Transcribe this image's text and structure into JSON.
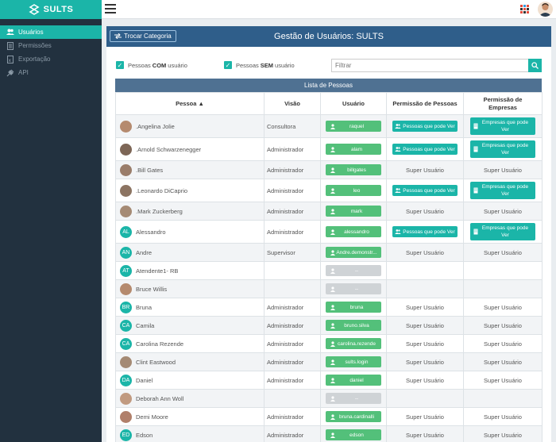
{
  "app": {
    "logo_text": "SULTS"
  },
  "sidebar": {
    "items": [
      {
        "label": "Usuários",
        "icon": "users-icon",
        "active": true
      },
      {
        "label": "Permissões",
        "icon": "document-icon",
        "active": false
      },
      {
        "label": "Exportação",
        "icon": "export-icon",
        "active": false
      },
      {
        "label": "API",
        "icon": "plug-icon",
        "active": false
      }
    ]
  },
  "panel": {
    "title": "Gestão de Usuários: SULTS",
    "category_button": "Trocar Categoria"
  },
  "filters": {
    "with_user_prefix": "Pessoas",
    "with_user_strong": "COM",
    "with_user_suffix": "usuário",
    "without_user_prefix": "Pessoas",
    "without_user_strong": "SEM",
    "without_user_suffix": "usuário",
    "filter_placeholder": "Filtrar"
  },
  "table": {
    "caption": "Lista de Pessoas",
    "headers": {
      "pessoa": "Pessoa",
      "visao": "Visão",
      "usuario": "Usuário",
      "perm_pessoas": "Permissão de Pessoas",
      "perm_empresas_1": "Permissão de",
      "perm_empresas_2": "Empresas"
    },
    "labels": {
      "pessoas_btn": "Pessoas que pode Ver",
      "empresas_btn_1": "Empresas que pode",
      "empresas_btn_2": "Ver",
      "super": "Super Usuário",
      "none": "--"
    },
    "rows": [
      {
        "name": ".Angelina Jolie",
        "initials": "",
        "visao": "Consultora",
        "user": "raquel",
        "pessoas": "btn",
        "empresas": "btn"
      },
      {
        "name": ".Arnold Schwarzenegger",
        "initials": "",
        "visao": "Administrador",
        "user": "alam",
        "pessoas": "btn",
        "empresas": "btn"
      },
      {
        "name": ".Bill Gates",
        "initials": "",
        "visao": "Administrador",
        "user": "billgates",
        "pessoas": "super",
        "empresas": "super"
      },
      {
        "name": ".Leonardo DiCaprio",
        "initials": "",
        "visao": "Administrador",
        "user": "leo",
        "pessoas": "btn",
        "empresas": "btn"
      },
      {
        "name": ".Mark Zuckerberg",
        "initials": "",
        "visao": "Administrador",
        "user": "mark",
        "pessoas": "super",
        "empresas": "super"
      },
      {
        "name": "Alessandro",
        "initials": "AL",
        "visao": "Administrador",
        "user": "alessandro",
        "pessoas": "btn",
        "empresas": "btn"
      },
      {
        "name": "Andre",
        "initials": "AN",
        "visao": "Supervisor",
        "user": "Andre.demonstr...",
        "pessoas": "super",
        "empresas": "super"
      },
      {
        "name": "Atendente1- RB",
        "initials": "AT",
        "visao": "",
        "user": "--",
        "pessoas": "",
        "empresas": ""
      },
      {
        "name": "Bruce Willis",
        "initials": "",
        "visao": "",
        "user": "--",
        "pessoas": "",
        "empresas": ""
      },
      {
        "name": "Bruna",
        "initials": "BR",
        "visao": "Administrador",
        "user": "bruna",
        "pessoas": "super",
        "empresas": "super"
      },
      {
        "name": "Camila",
        "initials": "CA",
        "visao": "Administrador",
        "user": "bruno.silva",
        "pessoas": "super",
        "empresas": "super"
      },
      {
        "name": "Carolina Rezende",
        "initials": "CA",
        "visao": "Administrador",
        "user": "carolina.rezende",
        "pessoas": "super",
        "empresas": "super"
      },
      {
        "name": "Clint Eastwood",
        "initials": "",
        "visao": "Administrador",
        "user": "sults.login",
        "pessoas": "super",
        "empresas": "super"
      },
      {
        "name": "Daniel",
        "initials": "DA",
        "visao": "Administrador",
        "user": "daniel",
        "pessoas": "super",
        "empresas": "super"
      },
      {
        "name": "Deborah Ann Woll",
        "initials": "",
        "visao": "",
        "user": "--",
        "pessoas": "",
        "empresas": ""
      },
      {
        "name": "Demi Moore",
        "initials": "",
        "visao": "Administrador",
        "user": "bruna.cardinalli",
        "pessoas": "super",
        "empresas": "super"
      },
      {
        "name": "Edson",
        "initials": "ED",
        "visao": "Administrador",
        "user": "edson",
        "pessoas": "super",
        "empresas": "super"
      }
    ]
  },
  "colors": {
    "accent": "#1bb5a8",
    "sidebar": "#22313f",
    "header": "#2f5e8a",
    "user_button": "#53c07a"
  }
}
